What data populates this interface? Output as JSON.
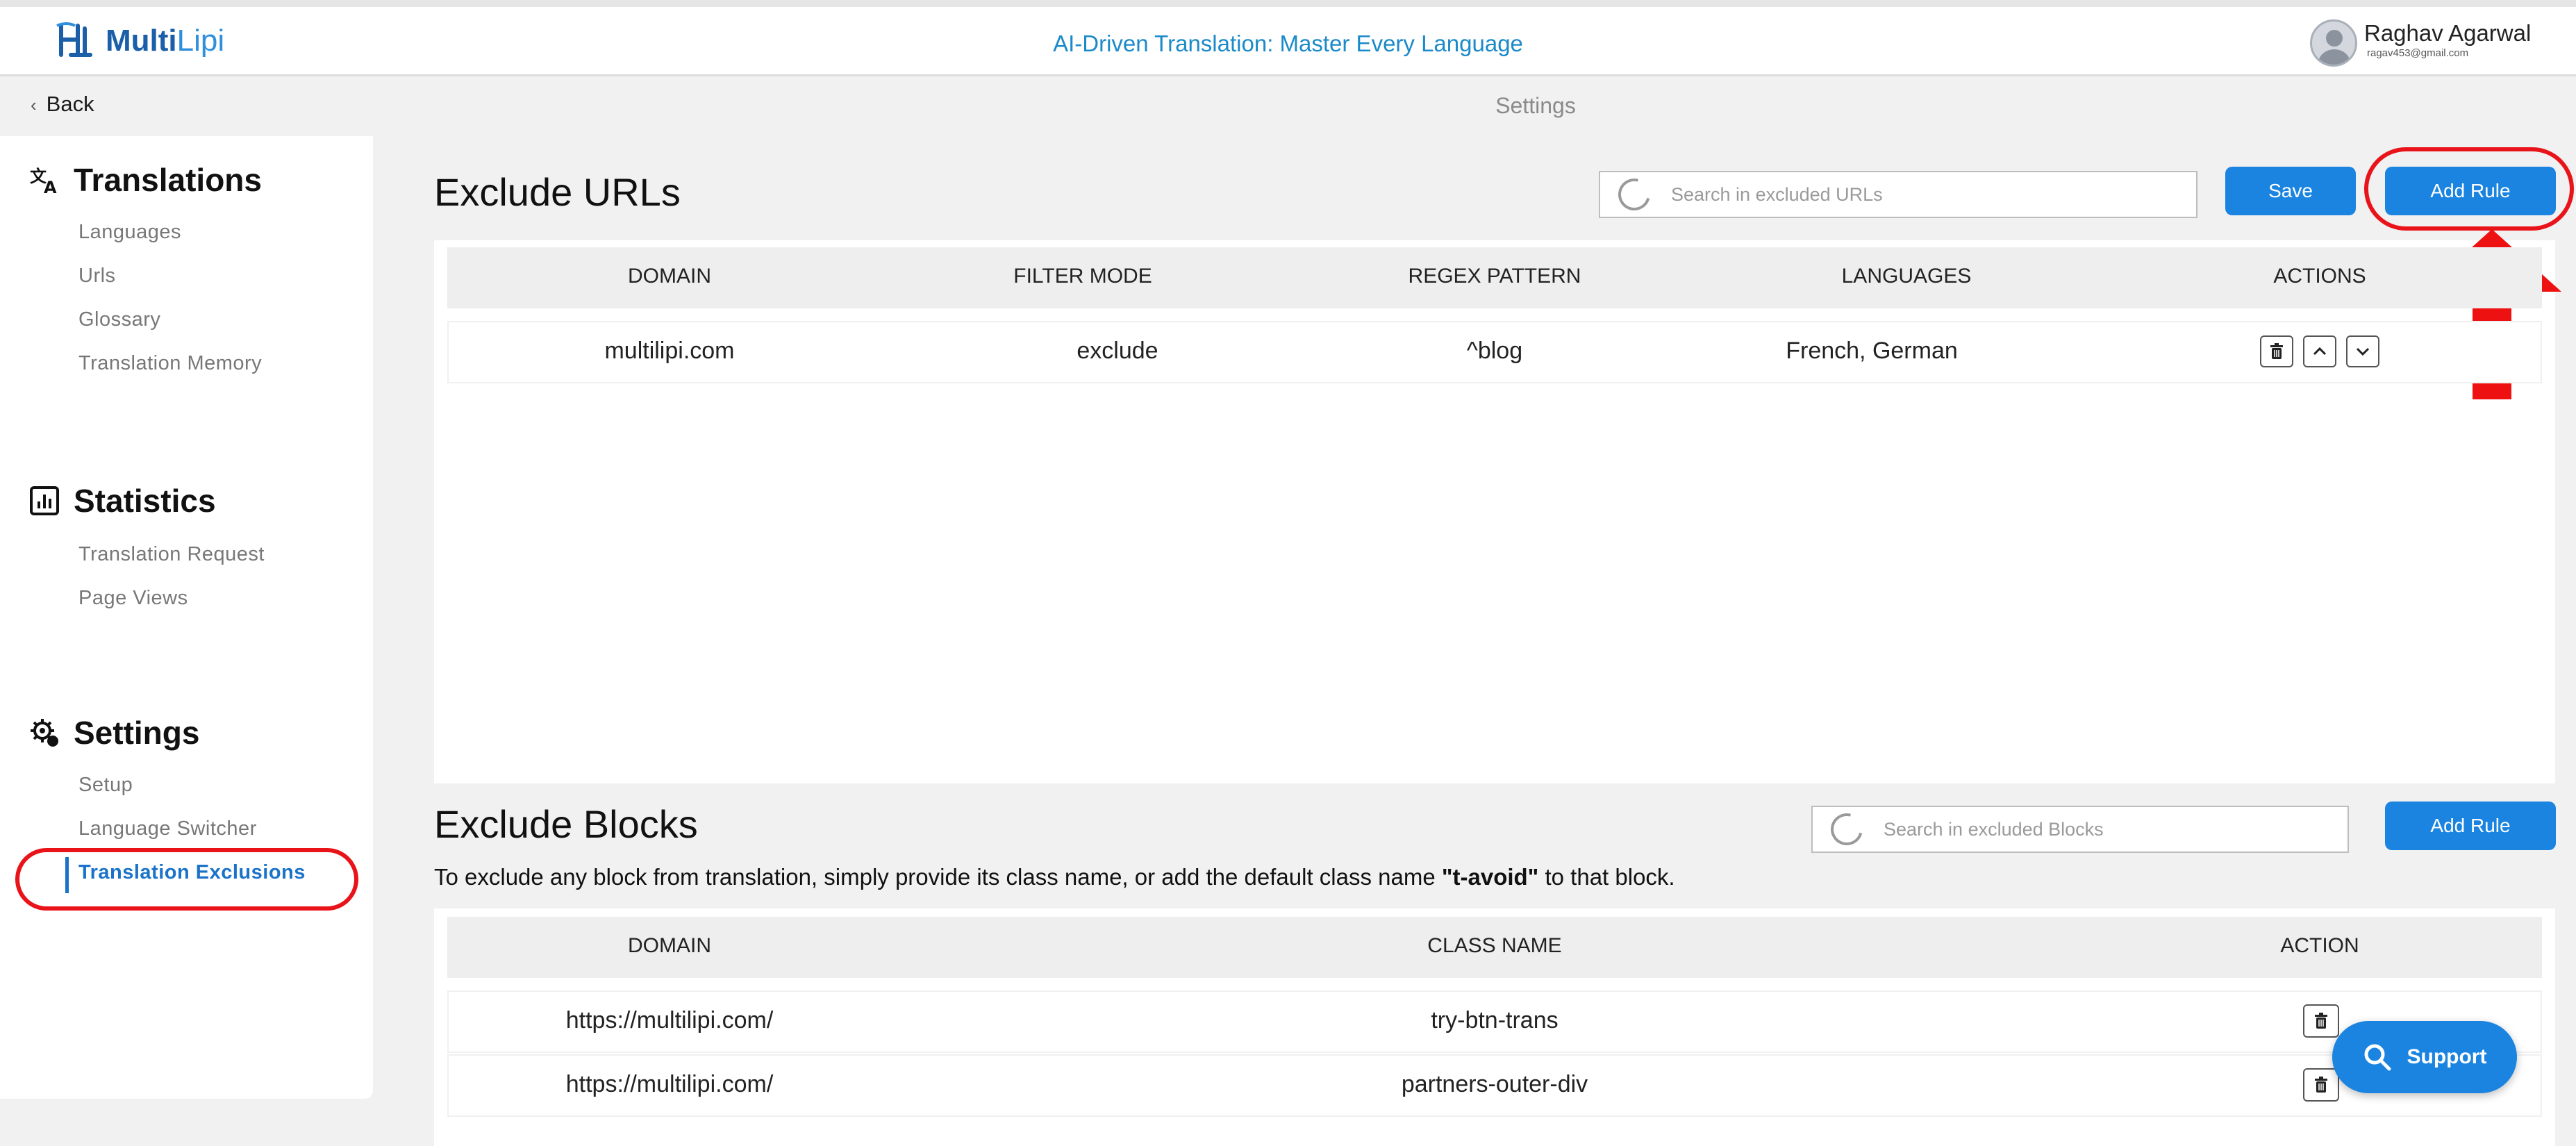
{
  "header": {
    "logo_text_a": "Multi",
    "logo_text_b": "Lipi",
    "tagline": "AI-Driven Translation: Master Every Language",
    "user_name": "Raghav Agarwal",
    "user_email": "ragav453@gmail.com"
  },
  "subheader": {
    "back_label": "Back",
    "page_title": "Settings"
  },
  "sidebar": {
    "translations": {
      "title": "Translations",
      "items": [
        "Languages",
        "Urls",
        "Glossary",
        "Translation Memory"
      ]
    },
    "statistics": {
      "title": "Statistics",
      "items": [
        "Translation Request",
        "Page Views"
      ]
    },
    "settings": {
      "title": "Settings",
      "items": [
        "Setup",
        "Language Switcher",
        "Translation Exclusions"
      ],
      "active": "Translation Exclusions"
    }
  },
  "exclude_urls": {
    "title": "Exclude URLs",
    "search_placeholder": "Search in excluded URLs",
    "save_label": "Save",
    "add_rule_label": "Add Rule",
    "columns": [
      "DOMAIN",
      "FILTER MODE",
      "REGEX PATTERN",
      "LANGUAGES",
      "ACTIONS"
    ],
    "rows": [
      {
        "domain": "multilipi.com",
        "filter_mode": "exclude",
        "regex": "^blog",
        "languages": "French, German"
      }
    ]
  },
  "exclude_blocks": {
    "title": "Exclude Blocks",
    "search_placeholder": "Search in excluded Blocks",
    "add_rule_label": "Add Rule",
    "description_pre": "To exclude any block from translation, simply provide its class name, or add the default class name ",
    "description_bold": "\"t-avoid\"",
    "description_post": " to that block.",
    "columns": [
      "DOMAIN",
      "CLASS NAME",
      "ACTION"
    ],
    "rows": [
      {
        "domain": "https://multilipi.com/",
        "class_name": "try-btn-trans"
      },
      {
        "domain": "https://multilipi.com/",
        "class_name": "partners-outer-div"
      }
    ]
  },
  "support": {
    "label": "Support"
  },
  "colors": {
    "accent": "#1a84e0",
    "annotation": "#e8141a",
    "active_nav": "#1a73c9",
    "tagline": "#1b8ac9"
  }
}
